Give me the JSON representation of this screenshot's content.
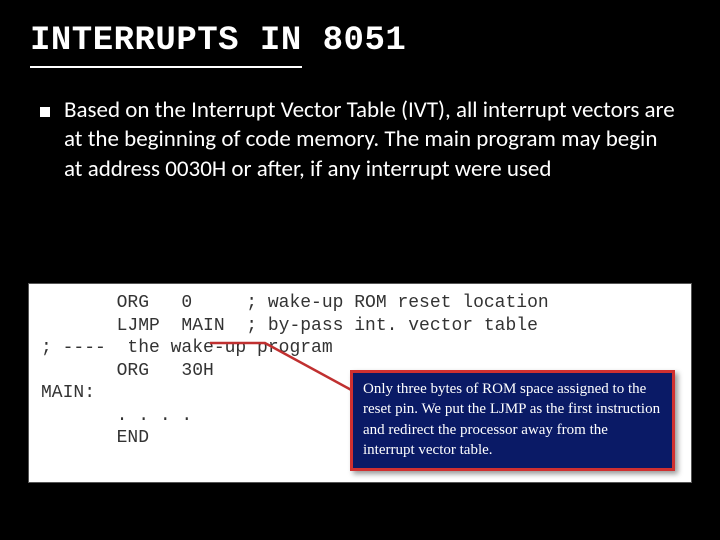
{
  "title": "INTERRUPTS IN 8051",
  "body": "Based on the Interrupt Vector Table (IVT), all interrupt vectors are at the beginning of code memory. The main program may begin at address 0030H or after, if any interrupt were used",
  "code": {
    "l1": "       ORG   0     ; wake-up ROM reset location",
    "l2": "       LJMP  MAIN  ; by-pass int. vector table",
    "l3": "; ----  the wake-up program",
    "l4": "       ORG   30H",
    "l5": "MAIN:",
    "l6": "       . . . .",
    "l7": "       END"
  },
  "note": "Only three bytes of ROM space assigned to the reset pin. We put the LJMP as the first instruction and redirect the processor away from the interrupt vector table."
}
